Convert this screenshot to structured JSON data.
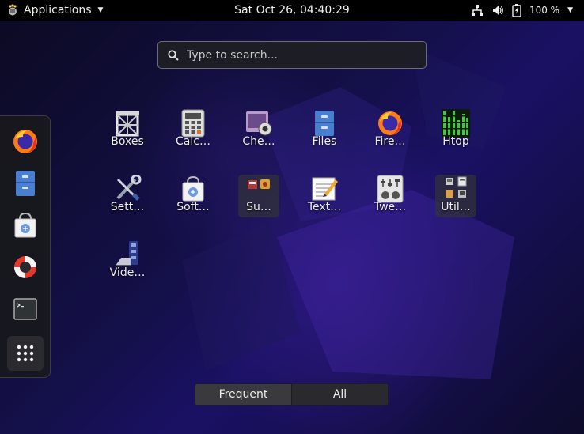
{
  "topbar": {
    "apps_label": "Applications",
    "clock": "Sat Oct 26, 04:40:29",
    "battery_label": "100 %"
  },
  "search": {
    "placeholder": "Type to search..."
  },
  "dash": {
    "items": [
      {
        "icon": "firefox-icon"
      },
      {
        "icon": "files-icon"
      },
      {
        "icon": "software-icon"
      },
      {
        "icon": "help-icon"
      },
      {
        "icon": "terminal-icon"
      },
      {
        "icon": "show-applications-icon"
      }
    ]
  },
  "apps": [
    {
      "label": "Boxes"
    },
    {
      "label": "Calc…"
    },
    {
      "label": "Che…"
    },
    {
      "label": "Files"
    },
    {
      "label": "Fire…"
    },
    {
      "label": "Htop"
    },
    {
      "label": "Sett…"
    },
    {
      "label": "Soft…"
    },
    {
      "label": "Su…"
    },
    {
      "label": "Text…"
    },
    {
      "label": "Twe…"
    },
    {
      "label": "Util…"
    },
    {
      "label": "Vide…"
    }
  ],
  "view_switch": {
    "frequent": "Frequent",
    "all": "All"
  }
}
